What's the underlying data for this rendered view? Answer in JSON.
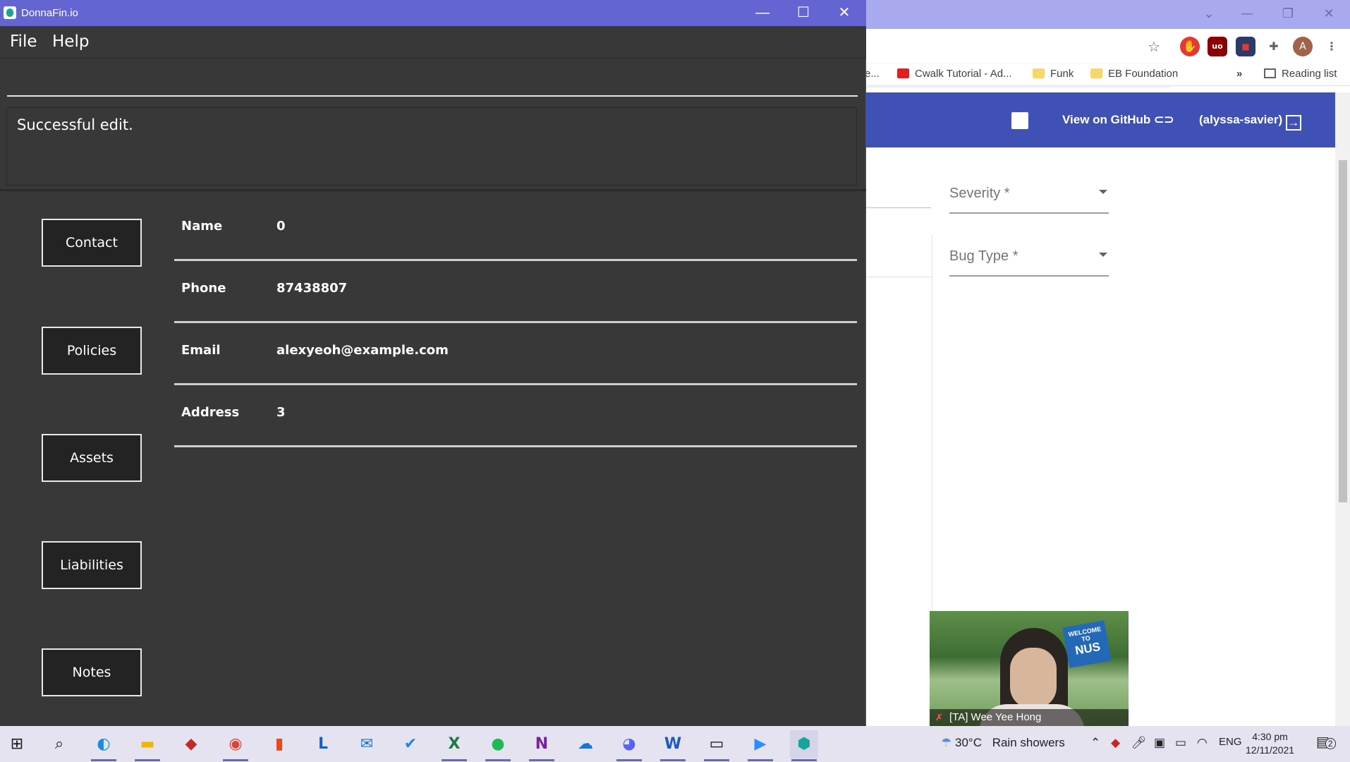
{
  "browser": {
    "bookmarks": [
      {
        "label": "e...",
        "icon": "folder-icon"
      },
      {
        "label": "Cwalk Tutorial - Ad...",
        "icon": "youtube-icon"
      },
      {
        "label": "Funk",
        "icon": "folder-icon"
      },
      {
        "label": "EB Foundation",
        "icon": "folder-icon"
      }
    ],
    "bookmarks_more": "»",
    "reading_list": "Reading list",
    "profile_initial": "A",
    "header": {
      "github_label": "View on GitHub",
      "user_label": "(alyssa-savier)"
    },
    "form": {
      "severity_label": "Severity *",
      "bug_type_label": "Bug Type *"
    },
    "colors": {
      "header": "#3f51b5"
    }
  },
  "video": {
    "participant": "[TA] Wee Yee Hong",
    "sign_line1": "WELCOME",
    "sign_line2": "TO",
    "sign_line3": "NUS"
  },
  "app": {
    "title": "DonnaFin.io",
    "menu": {
      "file": "File",
      "help": "Help"
    },
    "command_value": "",
    "result_text": "Successful edit.",
    "nav": {
      "contact": "Contact",
      "policies": "Policies",
      "assets": "Assets",
      "liabilities": "Liabilities",
      "notes": "Notes"
    },
    "details": [
      {
        "key": "Name",
        "value": "0"
      },
      {
        "key": "Phone",
        "value": "87438807"
      },
      {
        "key": "Email",
        "value": "alexyeoh@example.com"
      },
      {
        "key": "Address",
        "value": "3"
      }
    ],
    "colors": {
      "titlebar": "#6464d2",
      "background": "#383838",
      "button": "#232323"
    }
  },
  "taskbar": {
    "weather_temp": "30°C",
    "weather_desc": "Rain showers",
    "language": "ENG",
    "time": "4:30 pm",
    "date": "12/11/2021",
    "notification_count": "2"
  }
}
